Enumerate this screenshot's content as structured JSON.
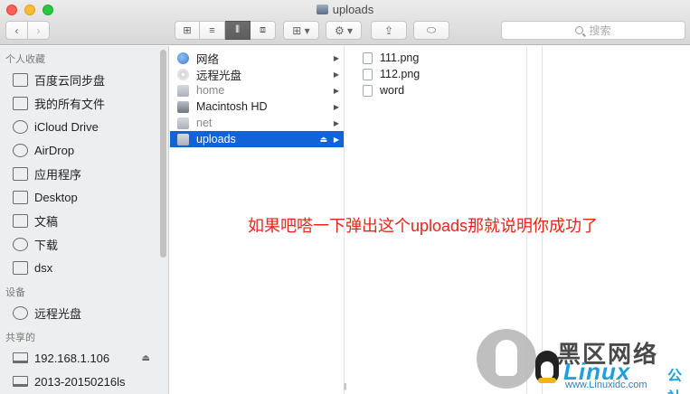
{
  "window": {
    "title": "uploads"
  },
  "toolbar": {
    "back_glyph": "‹",
    "forward_glyph": "›",
    "view_icons": [
      "⊞",
      "≡",
      "⫴",
      "⧈"
    ],
    "arrange_icon": "⊞ ▾",
    "action_icon": "⚙ ▾",
    "share_icon": "⇪",
    "tags_icon": "⬭",
    "search_placeholder": "搜索"
  },
  "sidebar": {
    "favorites_header": "个人收藏",
    "favorites": [
      {
        "label": "百度云同步盘",
        "icon": "folder-icon"
      },
      {
        "label": "我的所有文件",
        "icon": "all-files-icon"
      },
      {
        "label": "iCloud Drive",
        "icon": "cloud-icon"
      },
      {
        "label": "AirDrop",
        "icon": "airdrop-icon"
      },
      {
        "label": "应用程序",
        "icon": "applications-icon"
      },
      {
        "label": "Desktop",
        "icon": "desktop-icon"
      },
      {
        "label": "文稿",
        "icon": "documents-icon"
      },
      {
        "label": "下载",
        "icon": "downloads-icon"
      },
      {
        "label": "dsx",
        "icon": "home-icon"
      }
    ],
    "devices_header": "设备",
    "devices": [
      {
        "label": "远程光盘",
        "icon": "disc-icon"
      }
    ],
    "shared_header": "共享的",
    "shared": [
      {
        "label": "192.168.1.106",
        "icon": "monitor-icon",
        "eject": "⏏"
      },
      {
        "label": "2013-20150216ls",
        "icon": "monitor-icon"
      }
    ]
  },
  "column1": [
    {
      "label": "网络",
      "icon": "globe-icon",
      "dim": false,
      "selected": false
    },
    {
      "label": "远程光盘",
      "icon": "disc-icon",
      "dim": false,
      "selected": false
    },
    {
      "label": "home",
      "icon": "drive-icon",
      "dim": true,
      "selected": false
    },
    {
      "label": "Macintosh HD",
      "icon": "hard-disk-icon",
      "dim": false,
      "selected": false
    },
    {
      "label": "net",
      "icon": "drive-icon",
      "dim": true,
      "selected": false
    },
    {
      "label": "uploads",
      "icon": "drive-icon",
      "dim": false,
      "selected": true,
      "eject": "⏏"
    }
  ],
  "column2": [
    {
      "label": "111.png",
      "icon": "png-file-icon"
    },
    {
      "label": "112.png",
      "icon": "png-file-icon"
    },
    {
      "label": "word",
      "icon": "document-icon"
    }
  ],
  "annotation": "如果吧嗒一下弹出这个uploads那就说明你成功了",
  "watermark": {
    "cn": "黑区网络",
    "linux": "Linux",
    "she": "公社",
    "url": "www.Linuxidc.com"
  },
  "colors": {
    "selection": "#1363d8",
    "annotation": "#e8241a",
    "watermark_blue": "#1e9fe0"
  }
}
